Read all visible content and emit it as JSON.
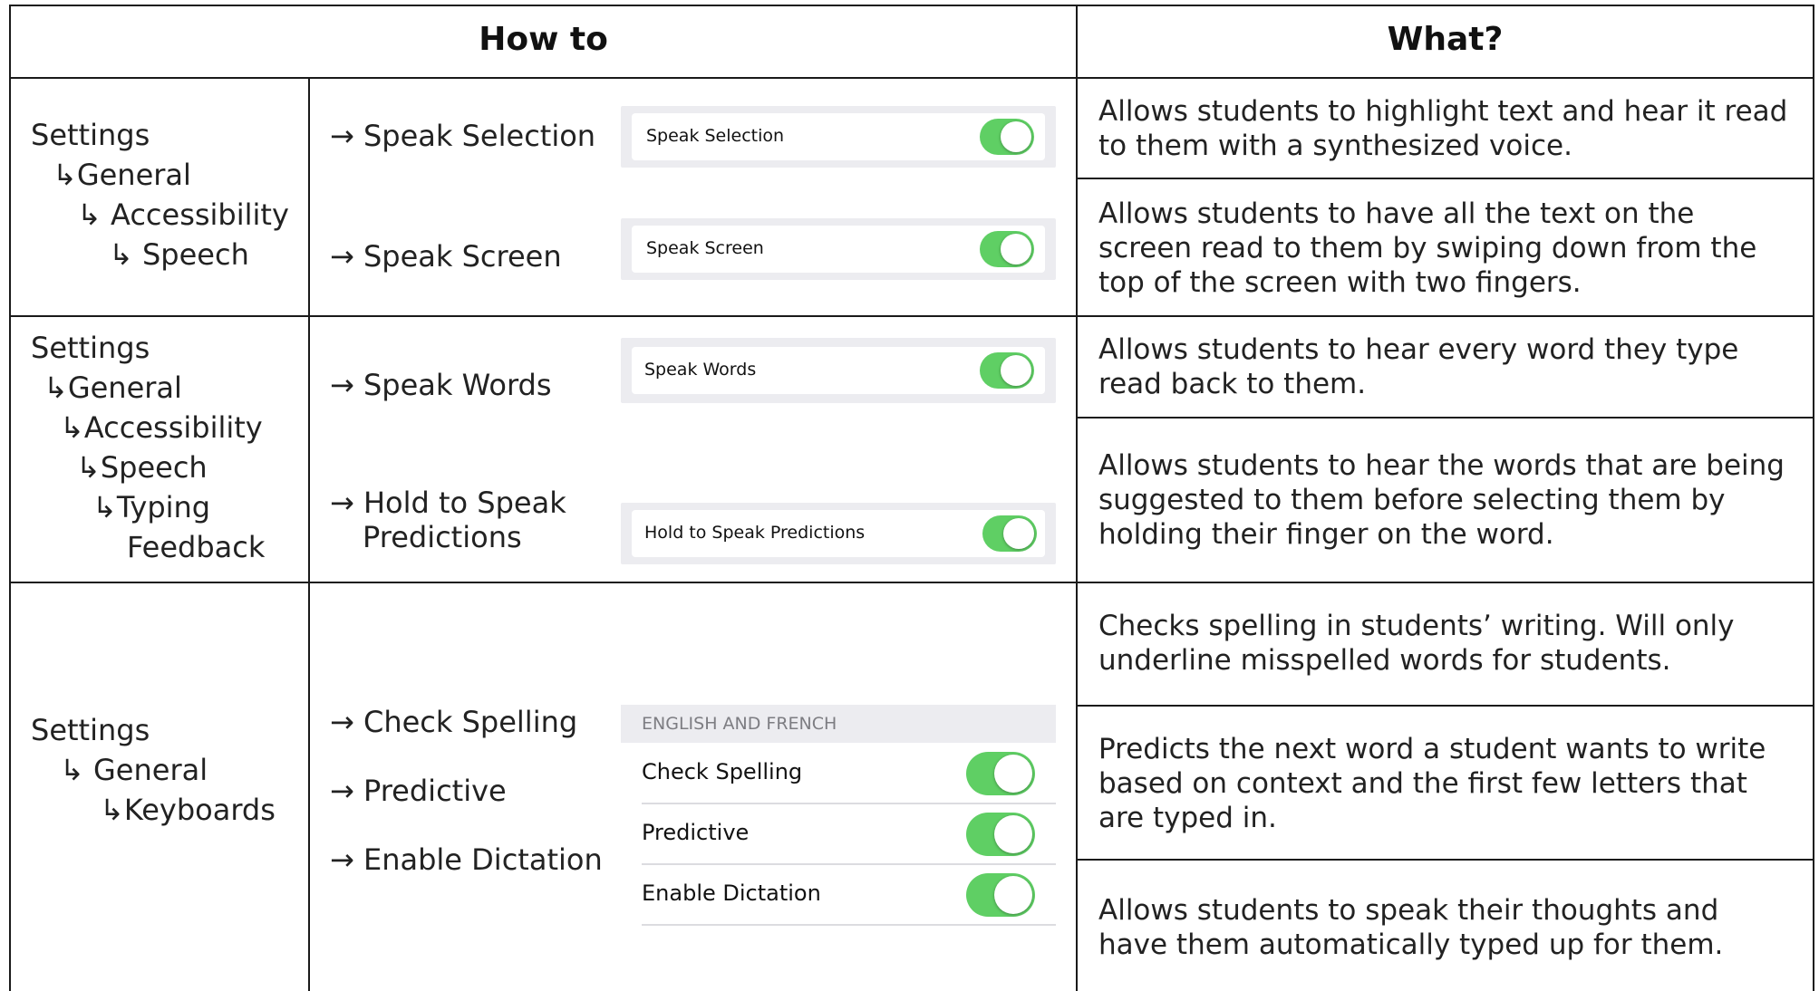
{
  "header": {
    "how_to": "How to",
    "what": "What?"
  },
  "rows": [
    {
      "path": [
        "Settings",
        "↳General",
        "↳ Accessibility",
        "↳ Speech"
      ],
      "steps": [
        "→ Speak Selection",
        "→ Speak Screen"
      ],
      "toggles": [
        "Speak Selection",
        "Speak Screen"
      ],
      "descriptions": [
        "Allows students to highlight text and hear it read to them with a synthesized voice.",
        "Allows students to have all the text on the screen read to them by swiping down from the top of the screen with two fingers."
      ]
    },
    {
      "path": [
        "Settings",
        "↳General",
        "↳Accessibility",
        "↳Speech",
        "↳Typing",
        "Feedback"
      ],
      "steps": [
        "→ Speak Words",
        "→ Hold to Speak",
        "Predictions"
      ],
      "toggles": [
        "Speak Words",
        "Hold to Speak Predictions"
      ],
      "descriptions": [
        "Allows students to hear every word they type read back to them.",
        "Allows students to hear the words that are being suggested to them before selecting them by holding their finger on the word."
      ]
    },
    {
      "path": [
        "Settings",
        "↳ General",
        "↳Keyboards"
      ],
      "steps": [
        "→ Check Spelling",
        "→ Predictive",
        "→ Enable Dictation"
      ],
      "section_header": "ENGLISH AND FRENCH",
      "toggles": [
        "Check Spelling",
        "Predictive",
        "Enable Dictation"
      ],
      "descriptions": [
        "Checks spelling in students’ writing. Will only underline misspelled words for students.",
        "Predicts the next word a student wants to write based on context and the first few letters that are typed in.",
        "Allows students to speak their thoughts and have them automatically typed up for them."
      ]
    }
  ],
  "colors": {
    "toggle_on": "#5fcf64",
    "panel_bg": "#ececf0",
    "border": "#1a1a1a"
  }
}
